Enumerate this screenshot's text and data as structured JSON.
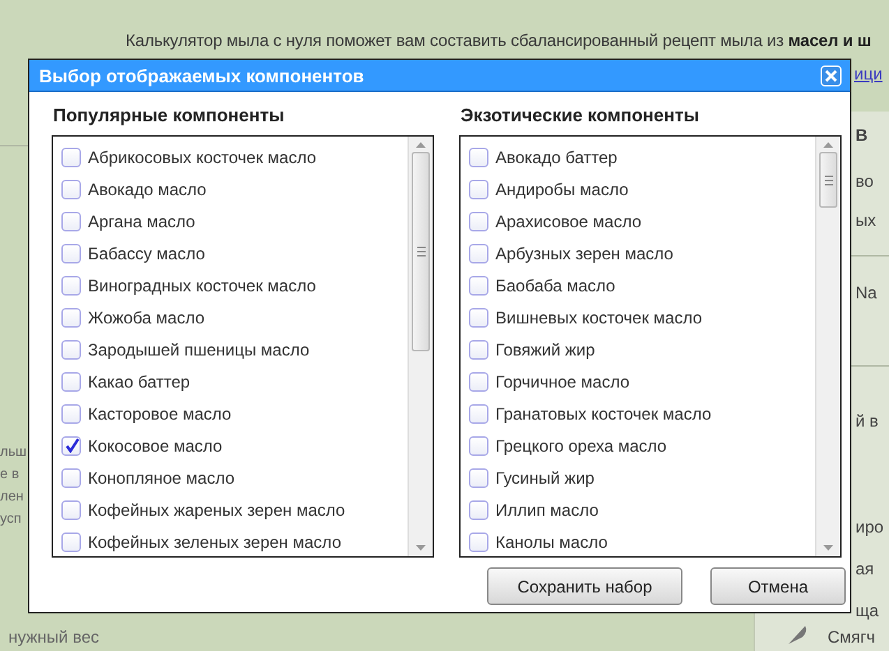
{
  "page": {
    "intro": "Калькулятор мыла с нуля поможет вам составить сбалансированный рецепт мыла из **масел и ш**",
    "link_fragment": "ици",
    "left_fragments": [
      "льш",
      "е в",
      "лен",
      "усп"
    ],
    "right_fragments": [
      "В",
      "во",
      "ых",
      "Na",
      "й в",
      "иро",
      "ая",
      "ща"
    ],
    "feather_label": "Смягч",
    "footer_fragment": "нужный вес"
  },
  "dialog": {
    "title": "Выбор отображаемых компонентов",
    "columns": [
      {
        "heading": "Популярные компоненты",
        "items": [
          {
            "label": "Абрикосовых косточек масло",
            "checked": false
          },
          {
            "label": "Авокадо масло",
            "checked": false
          },
          {
            "label": "Аргана масло",
            "checked": false
          },
          {
            "label": "Бабассу масло",
            "checked": false
          },
          {
            "label": "Виноградных косточек масло",
            "checked": false
          },
          {
            "label": "Жожоба масло",
            "checked": false
          },
          {
            "label": "Зародышей пшеницы масло",
            "checked": false
          },
          {
            "label": "Какао баттер",
            "checked": false
          },
          {
            "label": "Касторовое масло",
            "checked": false
          },
          {
            "label": "Кокосовое масло",
            "checked": true
          },
          {
            "label": "Конопляное масло",
            "checked": false
          },
          {
            "label": "Кофейных жареных зерен масло",
            "checked": false
          },
          {
            "label": "Кофейных зеленых зерен масло",
            "checked": false
          }
        ]
      },
      {
        "heading": "Экзотические компоненты",
        "items": [
          {
            "label": "Авокадо баттер",
            "checked": false
          },
          {
            "label": "Андиробы масло",
            "checked": false
          },
          {
            "label": "Арахисовое масло",
            "checked": false
          },
          {
            "label": "Арбузных зерен масло",
            "checked": false
          },
          {
            "label": "Баобаба масло",
            "checked": false
          },
          {
            "label": "Вишневых косточек масло",
            "checked": false
          },
          {
            "label": "Говяжий жир",
            "checked": false
          },
          {
            "label": "Горчичное масло",
            "checked": false
          },
          {
            "label": "Гранатовых косточек масло",
            "checked": false
          },
          {
            "label": "Грецкого ореха масло",
            "checked": false
          },
          {
            "label": "Гусиный жир",
            "checked": false
          },
          {
            "label": "Иллип масло",
            "checked": false
          },
          {
            "label": "Канолы масло",
            "checked": false
          }
        ]
      }
    ],
    "buttons": [
      "Сохранить набор",
      "Отмена"
    ]
  }
}
